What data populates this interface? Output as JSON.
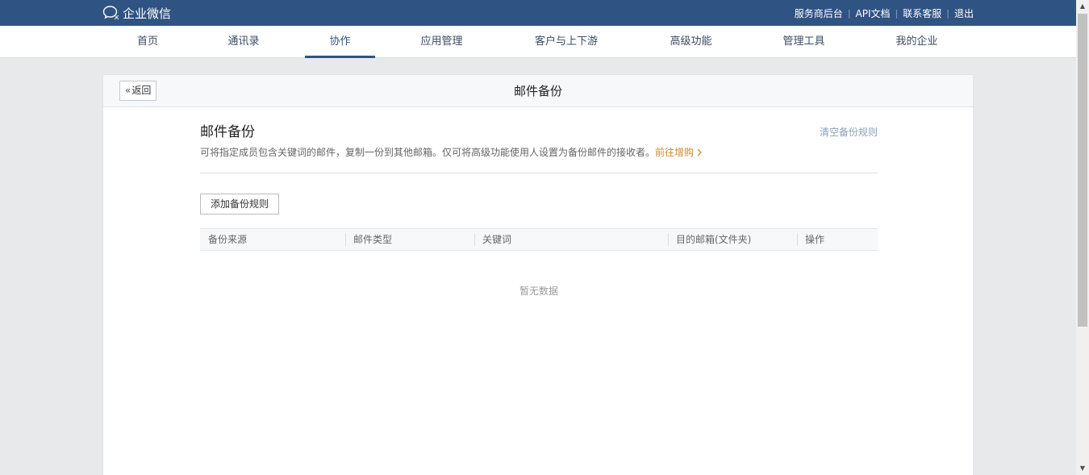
{
  "header": {
    "logo_text": "企业微信",
    "links": [
      "服务商后台",
      "API文档",
      "联系客服",
      "退出"
    ]
  },
  "nav": {
    "items": [
      "首页",
      "通讯录",
      "协作",
      "应用管理",
      "客户与上下游",
      "高级功能",
      "管理工具",
      "我的企业"
    ],
    "active_index": 2
  },
  "page": {
    "back_label": "返回",
    "title": "邮件备份"
  },
  "section": {
    "title": "邮件备份",
    "clear_link": "清空备份规则",
    "description": "可将指定成员包含关键词的邮件，复制一份到其他邮箱。仅可将高级功能使用人设置为备份邮件的接收者。",
    "buy_link": "前往增购",
    "add_button": "添加备份规则"
  },
  "table": {
    "columns": [
      "备份来源",
      "邮件类型",
      "关键词",
      "目的邮箱(文件夹)",
      "操作"
    ],
    "empty_text": "暂无数据"
  },
  "colors": {
    "brand": "#2f5483",
    "buy_link": "#c98a33",
    "clear_link": "#8aa0bd"
  }
}
